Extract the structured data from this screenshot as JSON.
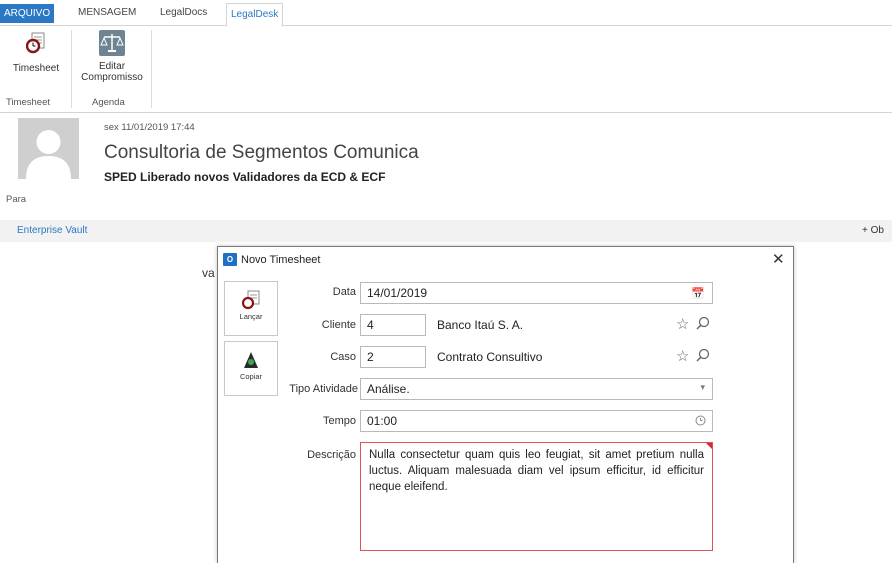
{
  "ribbon_tabs": {
    "arquivo": "ARQUIVO",
    "mensagem": "MENSAGEM",
    "legaldocs": "LegalDocs",
    "legaldesk": "LegalDesk"
  },
  "ribbon": {
    "timesheet_button": "Timesheet",
    "editar_line1": "Editar",
    "editar_line2": "Compromisso",
    "group_timesheet": "Timesheet",
    "group_agenda": "Agenda"
  },
  "message": {
    "datetime": "sex 11/01/2019 17:44",
    "sender": "Consultoria de Segmentos Comunica",
    "subject": "SPED Liberado novos Validadores da ECD & ECF",
    "para_label": "Para",
    "vault_link": "Enterprise Vault",
    "vault_right": "+ Ob",
    "body_partial": "va"
  },
  "dialog": {
    "title": "Novo Timesheet",
    "lancar_label": "Lançar",
    "copiar_label": "Copiar",
    "fields": {
      "data_label": "Data",
      "data_value": "14/01/2019",
      "cliente_label": "Cliente",
      "cliente_code": "4",
      "cliente_name": "Banco Itaú S. A.",
      "caso_label": "Caso",
      "caso_code": "2",
      "caso_name": "Contrato Consultivo",
      "tipo_label": "Tipo Atividade",
      "tipo_value": "Análise.",
      "tempo_label": "Tempo",
      "tempo_value": "01:00",
      "descricao_label": "Descrição",
      "descricao_value": "Nulla consectetur quam quis leo feugiat, sit amet pretium nulla luctus. Aliquam malesuada diam vel ipsum efficitur, id efficitur neque eleifend."
    }
  },
  "colors": {
    "accent": "#2b78c5",
    "error_border": "#e05252",
    "error_flag": "#d9272e"
  }
}
